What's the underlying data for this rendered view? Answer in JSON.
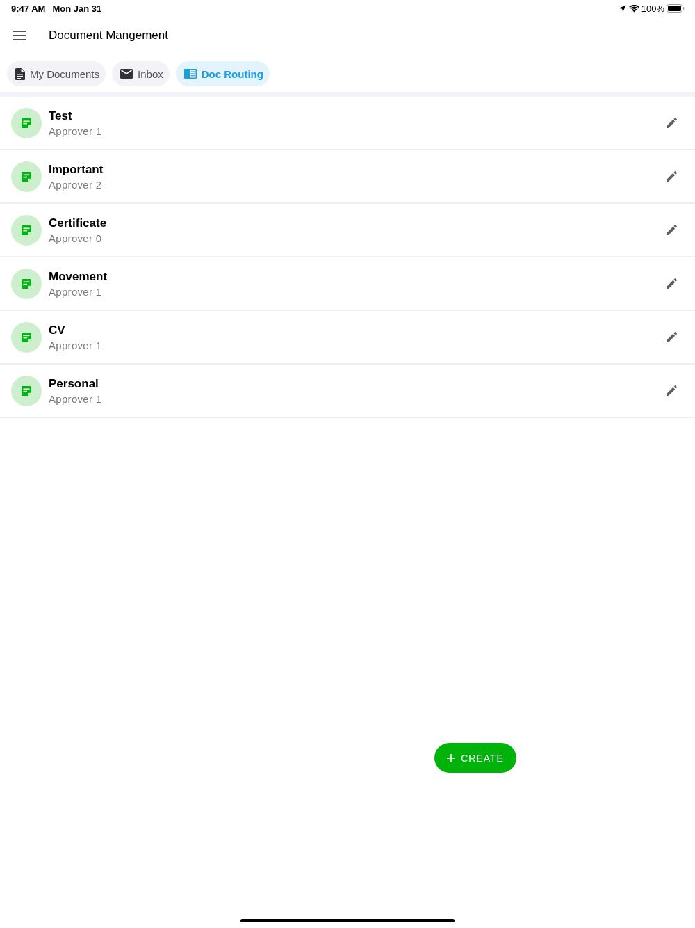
{
  "status_bar": {
    "time": "9:47 AM",
    "date": "Mon Jan 31",
    "battery": "100%"
  },
  "app_bar": {
    "title": "Document Mangement"
  },
  "tabs": [
    {
      "label": "My Documents",
      "kind": "document",
      "selected": false
    },
    {
      "label": "Inbox",
      "kind": "mail",
      "selected": false
    },
    {
      "label": "Doc Routing",
      "kind": "routing",
      "selected": true
    }
  ],
  "routes": [
    {
      "name": "Test",
      "approvers": "Approver 1"
    },
    {
      "name": "Important",
      "approvers": "Approver 2"
    },
    {
      "name": "Certificate",
      "approvers": "Approver 0"
    },
    {
      "name": "Movement",
      "approvers": "Approver 1"
    },
    {
      "name": "CV",
      "approvers": "Approver 1"
    },
    {
      "name": "Personal",
      "approvers": "Approver 1"
    }
  ],
  "create_button": {
    "label": "CREATE"
  }
}
